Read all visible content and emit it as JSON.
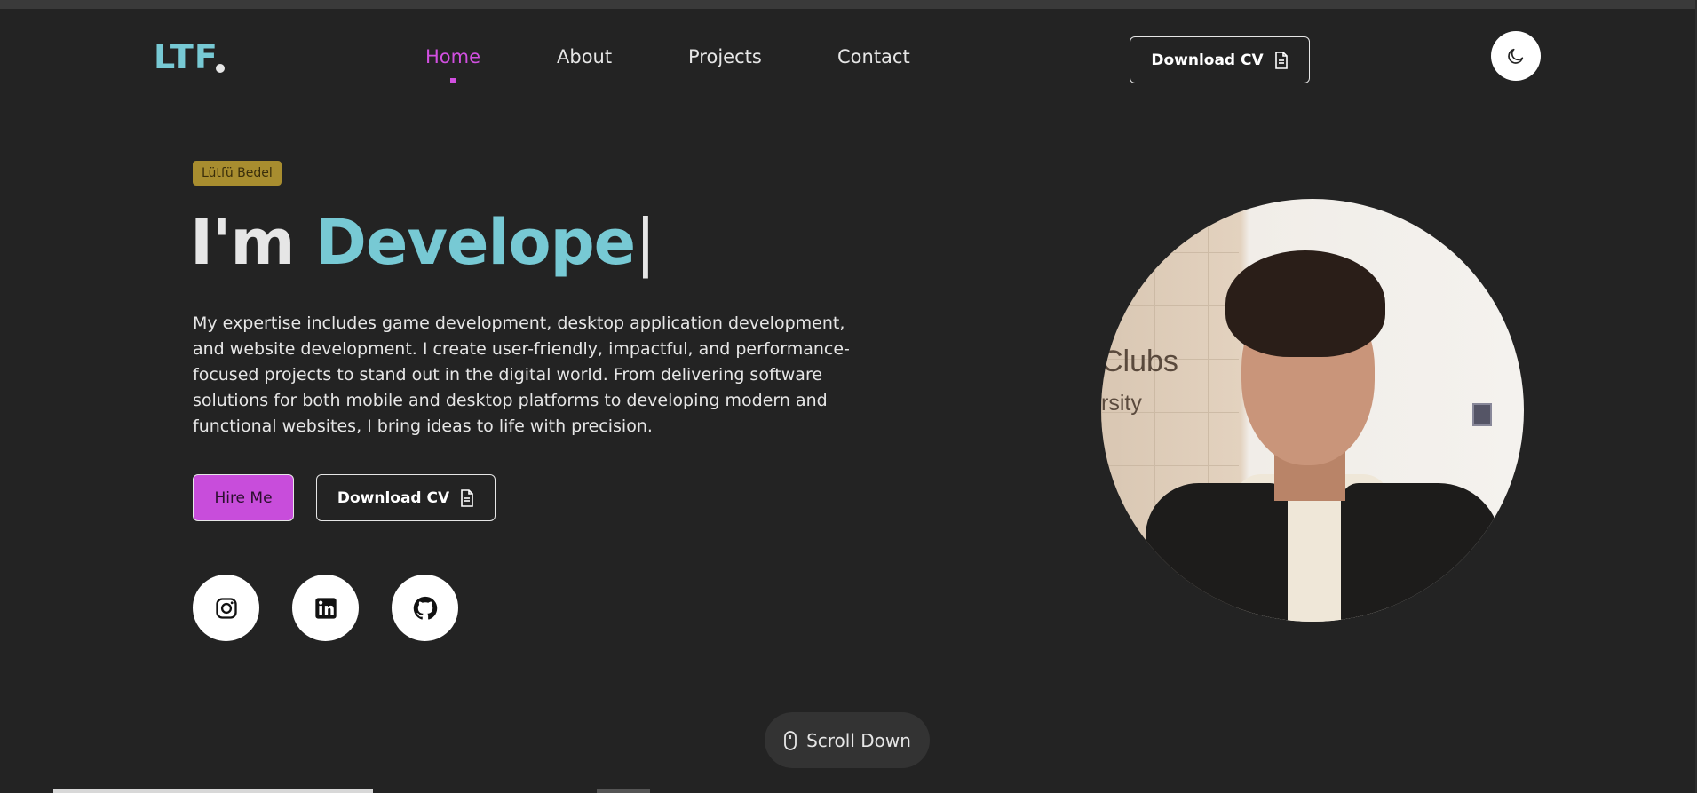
{
  "nav": {
    "logo": "LTF",
    "links": [
      {
        "label": "Home",
        "active": true
      },
      {
        "label": "About",
        "active": false
      },
      {
        "label": "Projects",
        "active": false
      },
      {
        "label": "Contact",
        "active": false
      }
    ],
    "download_cv_label": "Download CV",
    "theme_icon": "moon-icon"
  },
  "hero": {
    "tag": "Lütfü Bedel",
    "headline_prefix": "I'm",
    "headline_role": "Develope",
    "headline_cursor": "|",
    "intro": "My expertise includes game development, desktop application development, and website development. I create user-friendly, impactful, and performance-focused projects to stand out in the digital world. From delivering software solutions for both mobile and desktop platforms to developing modern and functional websites, I bring ideas to life with precision.",
    "hire_label": "Hire Me",
    "download_cv_label": "Download CV",
    "socials": [
      "instagram-icon",
      "linkedin-icon",
      "github-icon"
    ]
  },
  "portrait": {
    "sign_line1": "Clubs",
    "sign_line2": "rsity"
  },
  "scroll": {
    "label": "Scroll Down"
  },
  "colors": {
    "background": "#232323",
    "accent_cyan": "#77c9d4",
    "accent_magenta": "#c84ddb",
    "tag_gold": "#a88d2f"
  }
}
